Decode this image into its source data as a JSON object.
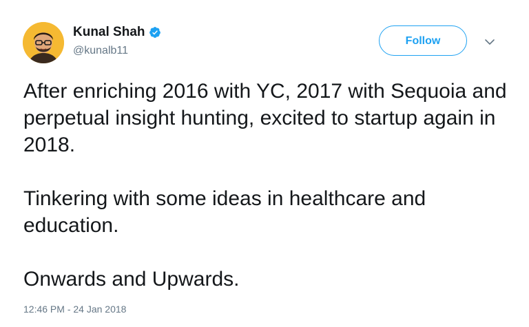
{
  "author": {
    "name": "Kunal Shah",
    "handle": "@kunalb11",
    "verified": true,
    "avatar_icon": "caricature-avatar",
    "avatar_bg": "#f5b932"
  },
  "actions": {
    "follow_label": "Follow",
    "menu_icon": "chevron-down-icon"
  },
  "tweet": {
    "paragraphs": [
      "After enriching 2016 with YC, 2017 with Sequoia and perpetual insight hunting, excited to startup again in 2018.",
      "Tinkering with some ideas in healthcare and education.",
      "Onwards and Upwards."
    ],
    "timestamp": "12:46 PM - 24 Jan 2018"
  },
  "colors": {
    "accent": "#1da1f2",
    "text": "#14171a",
    "secondary": "#657786"
  }
}
